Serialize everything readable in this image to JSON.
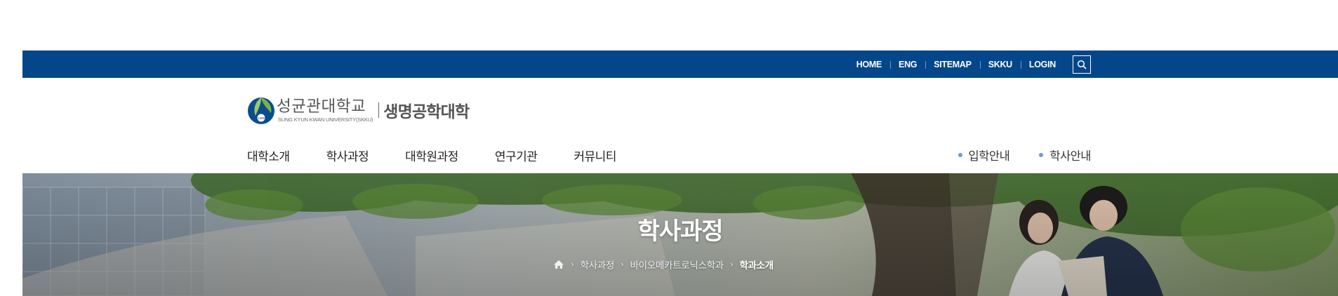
{
  "utility_nav": {
    "items": [
      "HOME",
      "ENG",
      "SITEMAP",
      "SKKU",
      "LOGIN"
    ],
    "search_icon": "search-icon"
  },
  "logo": {
    "university_kr": "성균관대학교",
    "university_en": "SUNG KYUN KWAN UNIVERSITY(SKKU)",
    "college": "생명공학대학"
  },
  "main_nav": {
    "items": [
      "대학소개",
      "학사과정",
      "대학원과정",
      "연구기관",
      "커뮤니티"
    ]
  },
  "quick_links": {
    "items": [
      "입학안내",
      "학사안내"
    ]
  },
  "visual": {
    "title": "학사과정",
    "breadcrumb": [
      "학사과정",
      "바이오메카트로닉스학과",
      "학과소개"
    ],
    "home_icon": "home-icon"
  },
  "colors": {
    "topbar": "#03468a",
    "quick_dot": "#6f9ad0"
  }
}
